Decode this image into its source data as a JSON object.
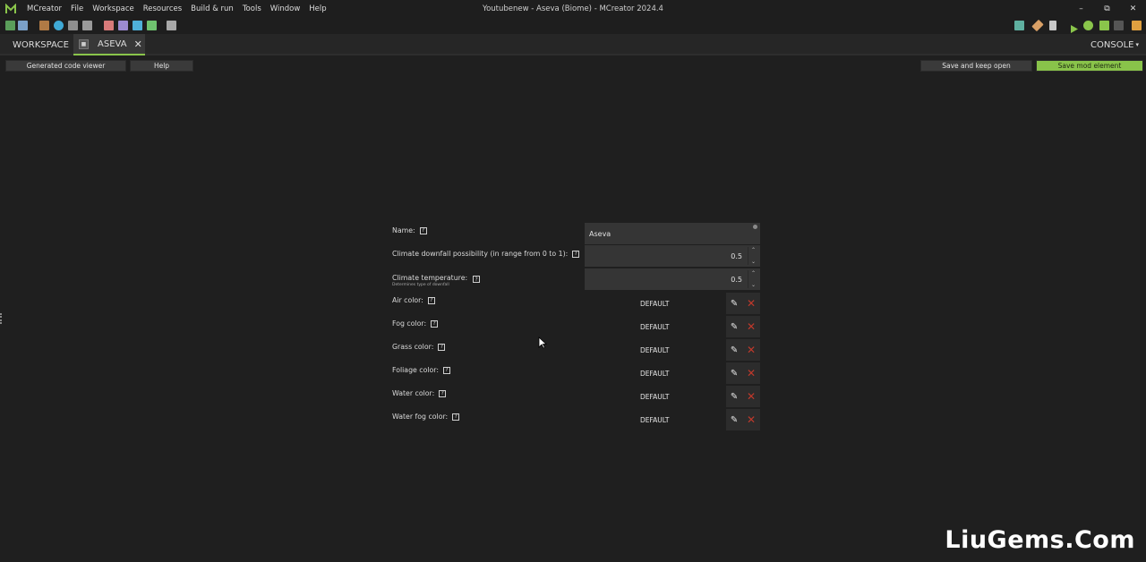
{
  "titlebar": {
    "menu": [
      "MCreator",
      "File",
      "Workspace",
      "Resources",
      "Build & run",
      "Tools",
      "Window",
      "Help"
    ],
    "window_title": "Youtubenew - Aseva (Biome) - MCreator 2024.4"
  },
  "tabs": {
    "workspace": "WORKSPACE",
    "element": "ASEVA",
    "console": "CONSOLE"
  },
  "actions": {
    "generated_code_viewer": "Generated code viewer",
    "help": "Help",
    "save_keep_open": "Save and keep open",
    "save_mod_element": "Save mod element"
  },
  "form": {
    "name_label": "Name:",
    "name_value": "Aseva",
    "downfall_label": "Climate downfall possibility (in range from 0 to 1):",
    "downfall_value": "0.5",
    "temperature_label": "Climate temperature:",
    "temperature_sublabel": "Determines type of downfall",
    "temperature_value": "0.5",
    "colors": [
      {
        "label": "Air color:",
        "value": "DEFAULT"
      },
      {
        "label": "Fog color:",
        "value": "DEFAULT"
      },
      {
        "label": "Grass color:",
        "value": "DEFAULT"
      },
      {
        "label": "Foliage color:",
        "value": "DEFAULT"
      },
      {
        "label": "Water color:",
        "value": "DEFAULT"
      },
      {
        "label": "Water fog color:",
        "value": "DEFAULT"
      }
    ]
  },
  "watermark": "LiuGems.Com",
  "colors": {
    "accent_green": "#89c34a",
    "clear_red": "#c0392b",
    "background": "#1f1f1f"
  }
}
